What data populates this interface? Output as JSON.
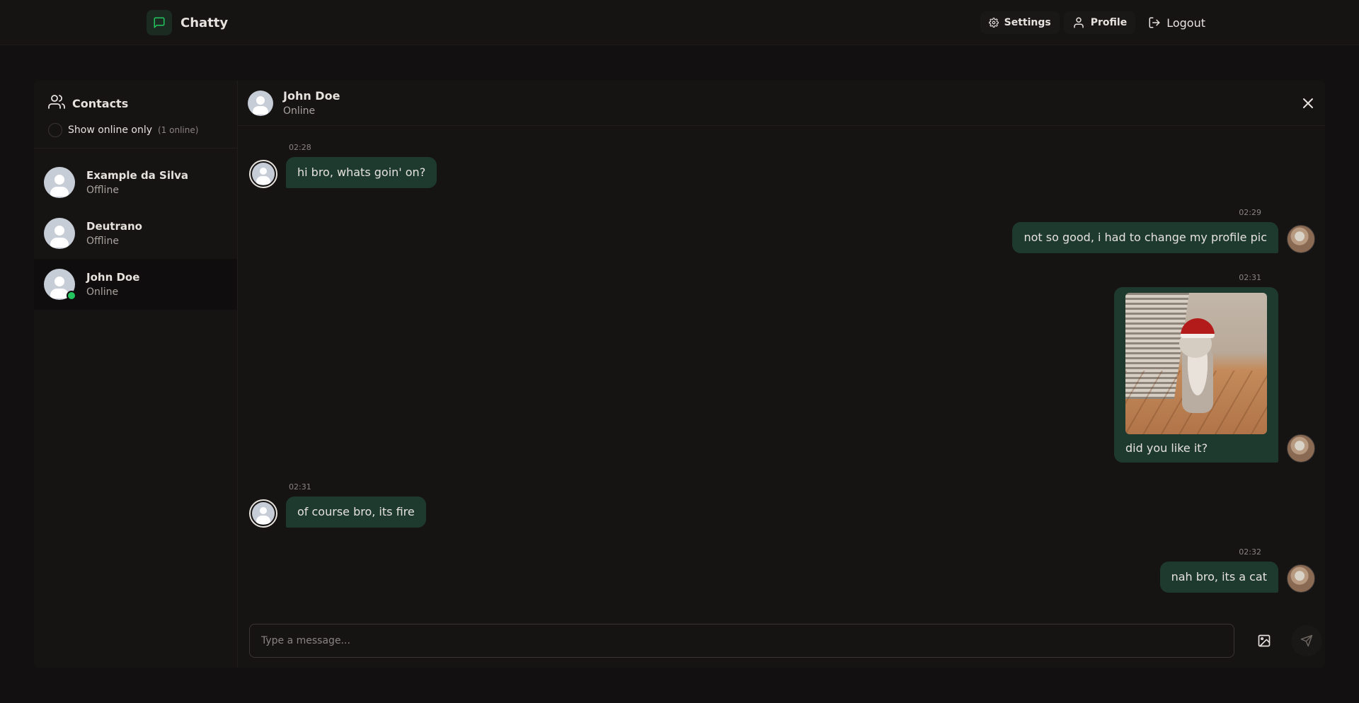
{
  "app": {
    "title": "Chatty"
  },
  "nav": {
    "settings_label": "Settings",
    "profile_label": "Profile",
    "logout_label": "Logout"
  },
  "sidebar": {
    "title": "Contacts",
    "filter_label": "Show online only",
    "online_count": "(1 online)",
    "contacts": [
      {
        "name": "Example da Silva",
        "status": "Offline"
      },
      {
        "name": "Deutrano",
        "status": "Offline"
      },
      {
        "name": "John Doe",
        "status": "Online"
      }
    ]
  },
  "chat": {
    "header": {
      "name": "John Doe",
      "status": "Online"
    },
    "messages": [
      {
        "time": "02:28",
        "text": "hi bro, whats goin' on?",
        "side": "left"
      },
      {
        "time": "02:29",
        "text": "not so good, i had to change my profile pic",
        "side": "right"
      },
      {
        "time": "02:31",
        "text": "did you like it?",
        "side": "right",
        "has_image": true
      },
      {
        "time": "02:31",
        "text": "of course bro, its fire",
        "side": "left"
      },
      {
        "time": "02:32",
        "text": "nah bro, its a cat",
        "side": "right"
      }
    ],
    "input": {
      "placeholder": "Type a message..."
    }
  },
  "colors": {
    "background": "#121010",
    "panel": "#161313",
    "bubble": "#1e3a2f",
    "online": "#22c55e",
    "brand_icon": "#22c55e"
  },
  "icons": {
    "brand": "message-square-icon",
    "settings": "gear-icon",
    "profile": "user-icon",
    "logout": "logout-icon",
    "contacts": "users-icon",
    "close": "close-icon",
    "image": "image-icon",
    "send": "send-icon"
  }
}
